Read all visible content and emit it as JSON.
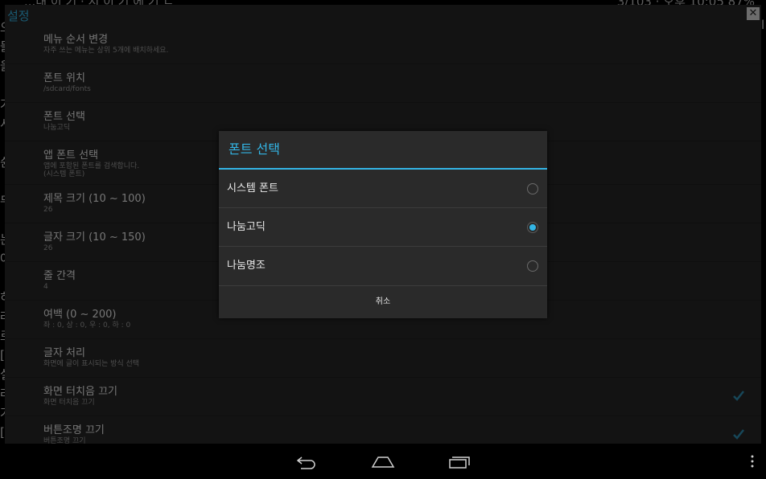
{
  "background": {
    "top_left": "...내 이 기 · 시 이 기 에 기 ㄴ",
    "top_right": "3/103 · 오후 10:05 87%",
    "left_chars": [
      "오",
      "들",
      "을",
      "",
      "가",
      "시",
      "",
      "쉰",
      "",
      "무",
      "",
      "논",
      "아",
      "",
      "히",
      "러",
      "르",
      "[",
      "실",
      "라",
      "가",
      "["
    ],
    "right_chars": [
      "l"
    ]
  },
  "settings": {
    "title": "설정",
    "close": "✕",
    "items": [
      {
        "title": "메뉴 순서 변경",
        "summary": "자주 쓰는 메뉴는 상위 5개에 배치하세요."
      },
      {
        "title": "폰트 위치",
        "summary": "/sdcard/fonts"
      },
      {
        "title": "폰트 선택",
        "summary": "나눔고딕"
      },
      {
        "title": "앱 폰트 선택",
        "summary": "앱에 포함된 폰트를 검색합니다.",
        "summary2": "(시스템 폰트)"
      },
      {
        "title": "제목 크기 (10 ~ 100)",
        "summary": "26"
      },
      {
        "title": "글자 크기 (10 ~ 150)",
        "summary": "26"
      },
      {
        "title": "줄 간격",
        "summary": "4"
      },
      {
        "title": "여백 (0 ~ 200)",
        "summary": "좌 : 0, 상 : 0, 우 : 0, 하 : 0"
      },
      {
        "title": "글자 처리",
        "summary": "화면에 글이 표시되는 방식 선택"
      },
      {
        "title": "화면 터치음 끄기",
        "summary": "화면 터치음 끄기",
        "checked": true
      },
      {
        "title": "버튼조명 끄기",
        "summary": "버튼조명 끄기",
        "checked": true
      }
    ]
  },
  "dialog": {
    "title": "폰트 선택",
    "options": [
      {
        "label": "시스템 폰트",
        "selected": false
      },
      {
        "label": "나눔고딕",
        "selected": true
      },
      {
        "label": "나눔명조",
        "selected": false
      }
    ],
    "cancel": "취소"
  },
  "colors": {
    "accent": "#33b5e5",
    "panel": "#272727",
    "dialog": "#2a2a2a"
  },
  "navbar": {
    "icons": [
      "back-icon",
      "home-icon",
      "recent-apps-icon",
      "overflow-menu-icon"
    ]
  }
}
